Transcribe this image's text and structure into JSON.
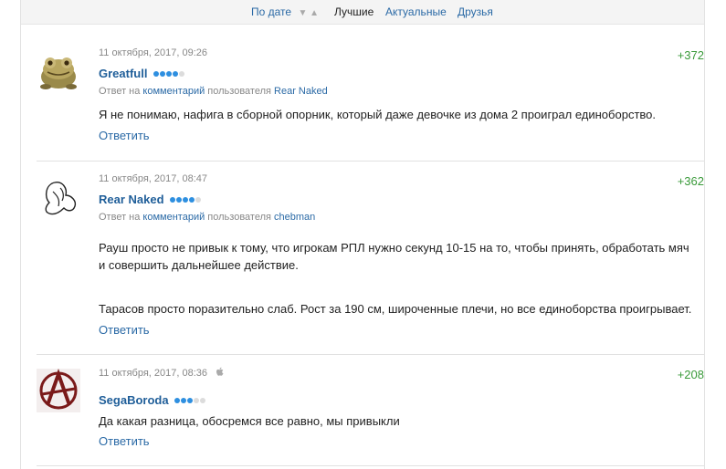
{
  "sort_bar": {
    "by_date": "По дате",
    "best": "Лучшие",
    "actual": "Актуальные",
    "friends": "Друзья"
  },
  "comments": [
    {
      "date": "11 октября, 2017, 09:26",
      "score": "+372",
      "author": "Greatfull",
      "rating_dots": 4,
      "reply_prefix": "Ответ на",
      "reply_link": "комментарий",
      "reply_middle": "пользователя",
      "reply_user": "Rear Naked",
      "lines": [
        "Я не понимаю, нафига в сборной опорник, который даже девочке из дома 2 проиграл единоборство."
      ],
      "answer": "Ответить",
      "avatar_icon": "frog-avatar-icon"
    },
    {
      "date": "11 октября, 2017, 08:47",
      "score": "+362",
      "author": "Rear Naked",
      "rating_dots": 4,
      "reply_prefix": "Ответ на",
      "reply_link": "комментарий",
      "reply_middle": "пользователя",
      "reply_user": "chebman",
      "lines": [
        "Рауш просто не привык к тому, что игрокам РПЛ нужно секунд 10-15 на то, чтобы принять, обработать мяч",
        "и совершить дальнейшее действие.",
        "Тарасов просто поразительно слаб. Рост за 190 см, широченные плечи, но все единоборства проигрывает."
      ],
      "answer": "Ответить",
      "avatar_icon": "line-drawing-avatar-icon"
    },
    {
      "date": "11 октября, 2017, 08:36",
      "score": "+208",
      "author": "SegaBoroda",
      "rating_dots": 3,
      "lines": [
        "Да какая разница, обосремся все равно, мы привыкли"
      ],
      "answer": "Ответить",
      "avatar_icon": "anarchy-avatar-icon",
      "device_icon": "apple-icon"
    }
  ],
  "colors": {
    "link": "#2b6aa6",
    "author": "#1f5e99",
    "score": "#3a9a3a",
    "dot_on": "#2e8fe0",
    "dot_off": "#dcdcdc"
  }
}
